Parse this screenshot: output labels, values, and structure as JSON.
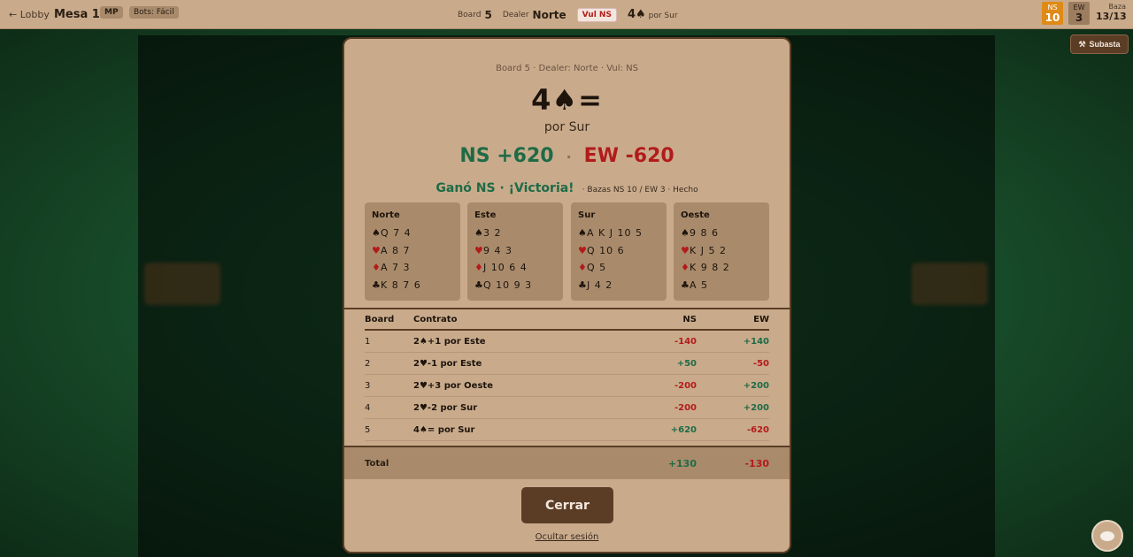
{
  "topbar": {
    "lobby": "← Lobby",
    "table_name": "Mesa 1",
    "mode_chip": "MP",
    "bots_chip": "Bots: Fácil",
    "board_label": "Board",
    "board_value": "5",
    "dealer_label": "Dealer",
    "dealer_value": "Norte",
    "vul_badge": "Vul NS",
    "contract": "4♠",
    "contract_by": "por Sur",
    "ns_label": "NS",
    "ns_score": "10",
    "ew_label": "EW",
    "ew_score": "3",
    "baza_label": "Baza",
    "baza_value": "13/13"
  },
  "subasta_button": "Subasta",
  "modal": {
    "subtitle": "Board 5 · Dealer: Norte · Vul: NS",
    "contract": "4♠=",
    "declarer": "por Sur",
    "ns_score": "NS +620",
    "separator": "·",
    "ew_score": "EW -620",
    "result": "Ganó NS · ¡Victoria!",
    "detail": "· Bazas NS 10 / EW 3 · Hecho",
    "hands": [
      {
        "name": "Norte",
        "spades": "Q 7 4",
        "hearts": "A 8 7",
        "diamonds": "A 7 3",
        "clubs": "K 8 7 6"
      },
      {
        "name": "Este",
        "spades": "3 2",
        "hearts": "9 4 3",
        "diamonds": "J 10 6 4",
        "clubs": "Q 10 9 3"
      },
      {
        "name": "Sur",
        "spades": "A K J 10 5",
        "hearts": "Q 10 6",
        "diamonds": "Q 5",
        "clubs": "J 4 2"
      },
      {
        "name": "Oeste",
        "spades": "9 8 6",
        "hearts": "K J 5 2",
        "diamonds": "K 9 8 2",
        "clubs": "A 5"
      }
    ],
    "suit_symbols": {
      "spades": "♠",
      "hearts": "♥",
      "diamonds": "♦",
      "clubs": "♣"
    },
    "results_headers": {
      "board": "Board",
      "contract": "Contrato",
      "ns": "NS",
      "ew": "EW"
    },
    "results": [
      {
        "board": "1",
        "contract": "2♠+1 por Este",
        "ns": "-140",
        "ew": "+140"
      },
      {
        "board": "2",
        "contract": "2♥-1 por Este",
        "ns": "+50",
        "ew": "-50"
      },
      {
        "board": "3",
        "contract": "2♥+3 por Oeste",
        "ns": "-200",
        "ew": "+200"
      },
      {
        "board": "4",
        "contract": "2♥-2 por Sur",
        "ns": "-200",
        "ew": "+200"
      },
      {
        "board": "5",
        "contract": "4♠= por Sur",
        "ns": "+620",
        "ew": "-620"
      }
    ],
    "total_label": "Total",
    "total_ns": "+130",
    "total_ew": "-130",
    "close_button": "Cerrar",
    "hide_link": "Ocultar sesión"
  },
  "colors": {
    "ns_green": "#1e6b46",
    "ew_red": "#b31b1b",
    "panel": "#c9ab8c",
    "button_brown": "#5b3d26",
    "ns_score_orange": "#e08a16"
  },
  "icons": {
    "subasta": "gavel-icon",
    "chat": "chat-icon"
  }
}
